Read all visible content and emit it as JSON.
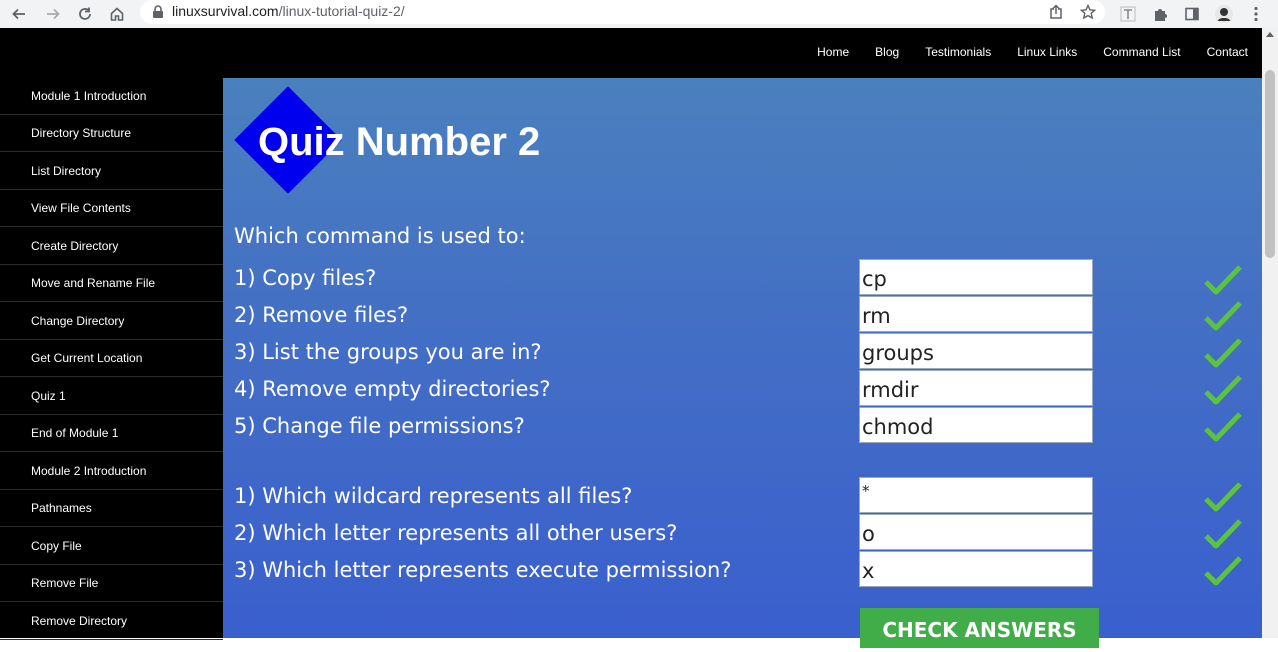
{
  "browser": {
    "url_host": "linuxsurvival.com",
    "url_path": "/linux-tutorial-quiz-2/",
    "icons": [
      "back-icon",
      "forward-icon",
      "reload-icon",
      "home-icon",
      "lock-icon",
      "share-icon",
      "star-icon",
      "text-extension-icon",
      "puzzle-icon",
      "side-panel-icon",
      "profile-avatar",
      "menu-dots-icon"
    ]
  },
  "topnav": [
    "Home",
    "Blog",
    "Testimonials",
    "Linux Links",
    "Command List",
    "Contact"
  ],
  "sidebar": [
    "Module 1 Introduction",
    "Directory Structure",
    "List Directory",
    "View File Contents",
    "Create Directory",
    "Move and Rename File",
    "Change Directory",
    "Get Current Location",
    "Quiz 1",
    "End of Module 1",
    "Module 2 Introduction",
    "Pathnames",
    "Copy File",
    "Remove File",
    "Remove Directory"
  ],
  "quiz": {
    "title": "Quiz Number 2",
    "intro": "Which command is used to:",
    "section1": [
      {
        "question": "1) Copy files?",
        "answer": "cp"
      },
      {
        "question": "2) Remove files?",
        "answer": "rm"
      },
      {
        "question": "3) List the groups you are in?",
        "answer": "groups"
      },
      {
        "question": "4) Remove empty directories?",
        "answer": "rmdir"
      },
      {
        "question": "5) Change file permissions?",
        "answer": "chmod"
      }
    ],
    "section2": [
      {
        "question": "1) Which wildcard represents all files?",
        "answer": "*"
      },
      {
        "question": "2) Which letter represents all other users?",
        "answer": "o"
      },
      {
        "question": "3) Which letter represents execute permission?",
        "answer": "x"
      }
    ],
    "check_button": "CHECK ANSWERS"
  },
  "colors": {
    "header_bg": "#000000",
    "main_bg_top": "#4a80be",
    "main_bg_bottom": "#3a5fce",
    "diamond": "#0000ee",
    "check": "#5cc43c",
    "button": "#40ad48"
  }
}
